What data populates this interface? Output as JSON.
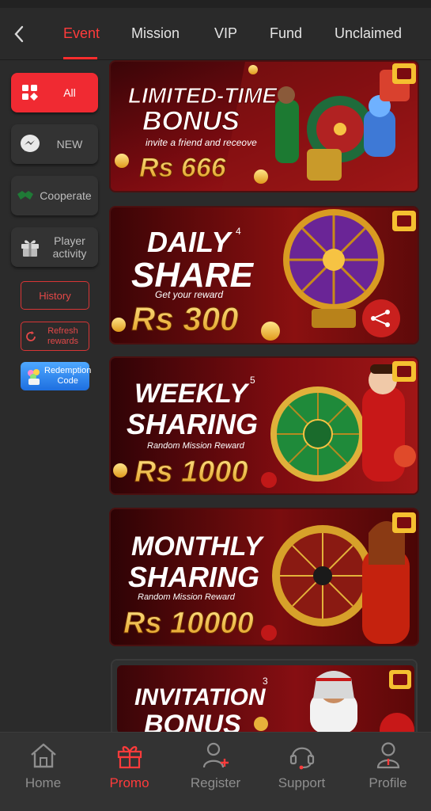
{
  "header": {
    "tabs": [
      {
        "label": "Event",
        "active": true
      },
      {
        "label": "Mission",
        "active": false
      },
      {
        "label": "VIP",
        "active": false
      },
      {
        "label": "Fund",
        "active": false
      },
      {
        "label": "Unclaimed",
        "active": false
      }
    ]
  },
  "sidebar": {
    "categories": [
      {
        "label": "All",
        "icon": "grid-icon",
        "active": true
      },
      {
        "label": "NEW",
        "icon": "messenger-icon",
        "active": false
      },
      {
        "label": "Cooperate",
        "icon": "handshake-icon",
        "active": false
      },
      {
        "label": "Player activity",
        "icon": "gift-icon",
        "active": false
      }
    ],
    "history_label": "History",
    "refresh_label": "Refresh rewards",
    "redeem_label": "Redemption Code"
  },
  "banners": [
    {
      "line1": "LIMITED-TIME",
      "line2": "BONUS",
      "sub": "invite a friend and receove",
      "amount": "Rs 666",
      "badge": ""
    },
    {
      "line1": "DAILY",
      "line2": "SHARE",
      "sub": "Get your reward",
      "amount": "Rs 300",
      "badge": "4"
    },
    {
      "line1": "WEEKLY",
      "line2": "SHARING",
      "sub": "Random Mission Reward",
      "amount": "Rs 1000",
      "badge": "5"
    },
    {
      "line1": "MONTHLY",
      "line2": "SHARING",
      "sub": "Random Mission Reward",
      "amount": "Rs 10000",
      "badge": ""
    },
    {
      "line1": "INVITATION",
      "line2": "BONUS",
      "sub": "",
      "amount": "",
      "badge": "3"
    }
  ],
  "bottom_nav": [
    {
      "label": "Home",
      "icon": "home-icon",
      "active": false
    },
    {
      "label": "Promo",
      "icon": "gift-icon",
      "active": true
    },
    {
      "label": "Register",
      "icon": "add-user-icon",
      "active": false
    },
    {
      "label": "Support",
      "icon": "headset-icon",
      "active": false
    },
    {
      "label": "Profile",
      "icon": "user-icon",
      "active": false
    }
  ],
  "colors": {
    "accent": "#f02a32",
    "background": "#2b2b2b",
    "gold": "#f6c343"
  }
}
